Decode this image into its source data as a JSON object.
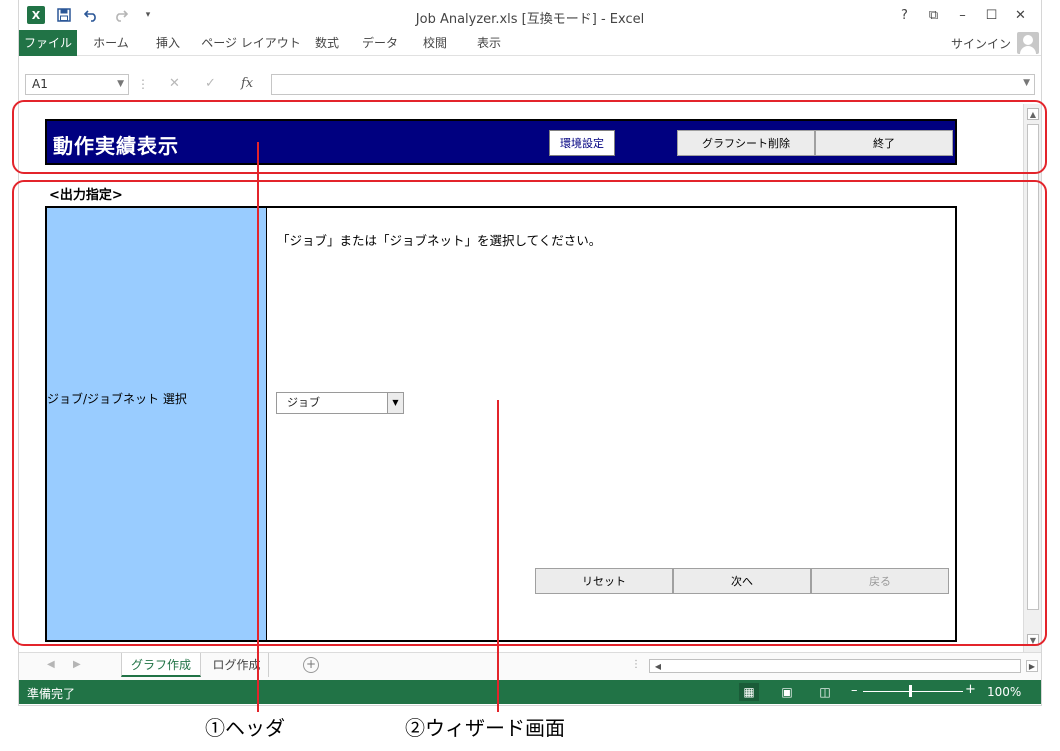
{
  "window": {
    "title": "Job Analyzer.xls  [互換モード] - Excel",
    "app_icon": "X",
    "controls": [
      "?",
      "⧉",
      "–",
      "☐",
      "✕"
    ]
  },
  "ribbon": {
    "tabs": [
      "ファイル",
      "ホーム",
      "挿入",
      "ページ レイアウト",
      "数式",
      "データ",
      "校閲",
      "表示"
    ],
    "signin": "サインイン"
  },
  "formula_bar": {
    "name_box": "A1",
    "formula": ""
  },
  "header": {
    "title": "動作実績表示",
    "env_button": "環境設定",
    "delete_button": "グラフシート削除",
    "quit_button": "終了"
  },
  "section_label": "<出力指定>",
  "wizard": {
    "left_label": "ジョブ/ジョブネット  選択",
    "message": "「ジョブ」または「ジョブネット」を選択してください。",
    "combo_value": "ジョブ",
    "reset_button": "リセット",
    "next_button": "次へ",
    "back_button": "戻る"
  },
  "sheet_tabs": [
    "グラフ作成",
    "ログ作成"
  ],
  "status": {
    "text": "準備完了",
    "zoom": "100%"
  },
  "annotations": {
    "header_label": "①ヘッダ",
    "wizard_label": "②ウィザード画面",
    "color": "#e3242b"
  },
  "colors": {
    "excel_green": "#217346",
    "banner_navy": "#000080",
    "wizard_left_blue": "#99ccff"
  }
}
